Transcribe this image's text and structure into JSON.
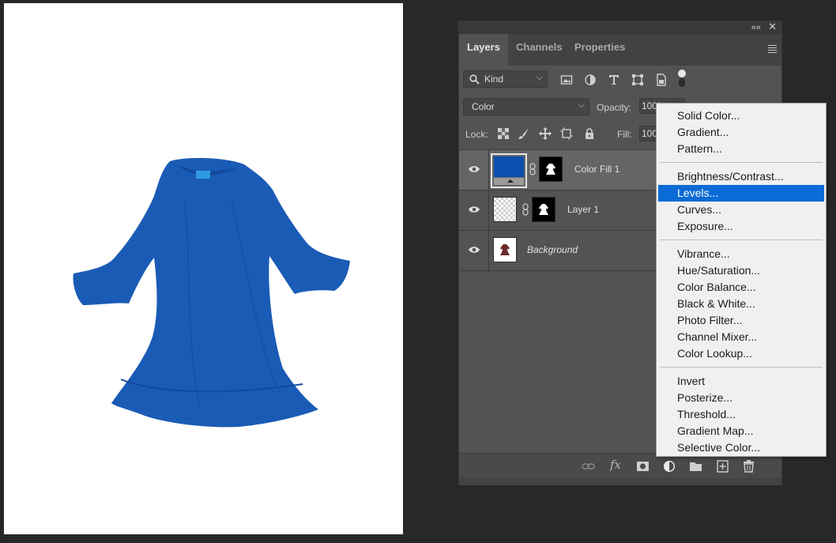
{
  "panel": {
    "tabs": [
      {
        "label": "Layers",
        "active": true
      },
      {
        "label": "Channels",
        "active": false
      },
      {
        "label": "Properties",
        "active": false
      }
    ],
    "filter": {
      "kind_label": "Kind"
    },
    "blend_mode": "Color",
    "opacity_label": "Opacity:",
    "opacity_value": "100%",
    "lock_label": "Lock:",
    "fill_label": "Fill:",
    "fill_value": "100",
    "layers": [
      {
        "name": "Color Fill 1",
        "selected": true,
        "italic": false
      },
      {
        "name": "Layer 1",
        "selected": false,
        "italic": false
      },
      {
        "name": "Background",
        "selected": false,
        "italic": true
      }
    ]
  },
  "context_menu": {
    "groups": [
      [
        "Solid Color...",
        "Gradient...",
        "Pattern..."
      ],
      [
        "Brightness/Contrast...",
        "Levels...",
        "Curves...",
        "Exposure..."
      ],
      [
        "Vibrance...",
        "Hue/Saturation...",
        "Color Balance...",
        "Black & White...",
        "Photo Filter...",
        "Channel Mixer...",
        "Color Lookup..."
      ],
      [
        "Invert",
        "Posterize...",
        "Threshold...",
        "Gradient Map...",
        "Selective Color..."
      ]
    ],
    "highlighted": "Levels..."
  },
  "colors": {
    "dress": "#1a5bb6",
    "fill_swatch": "#0d4fb0",
    "menu_highlight": "#0a6bd6"
  }
}
